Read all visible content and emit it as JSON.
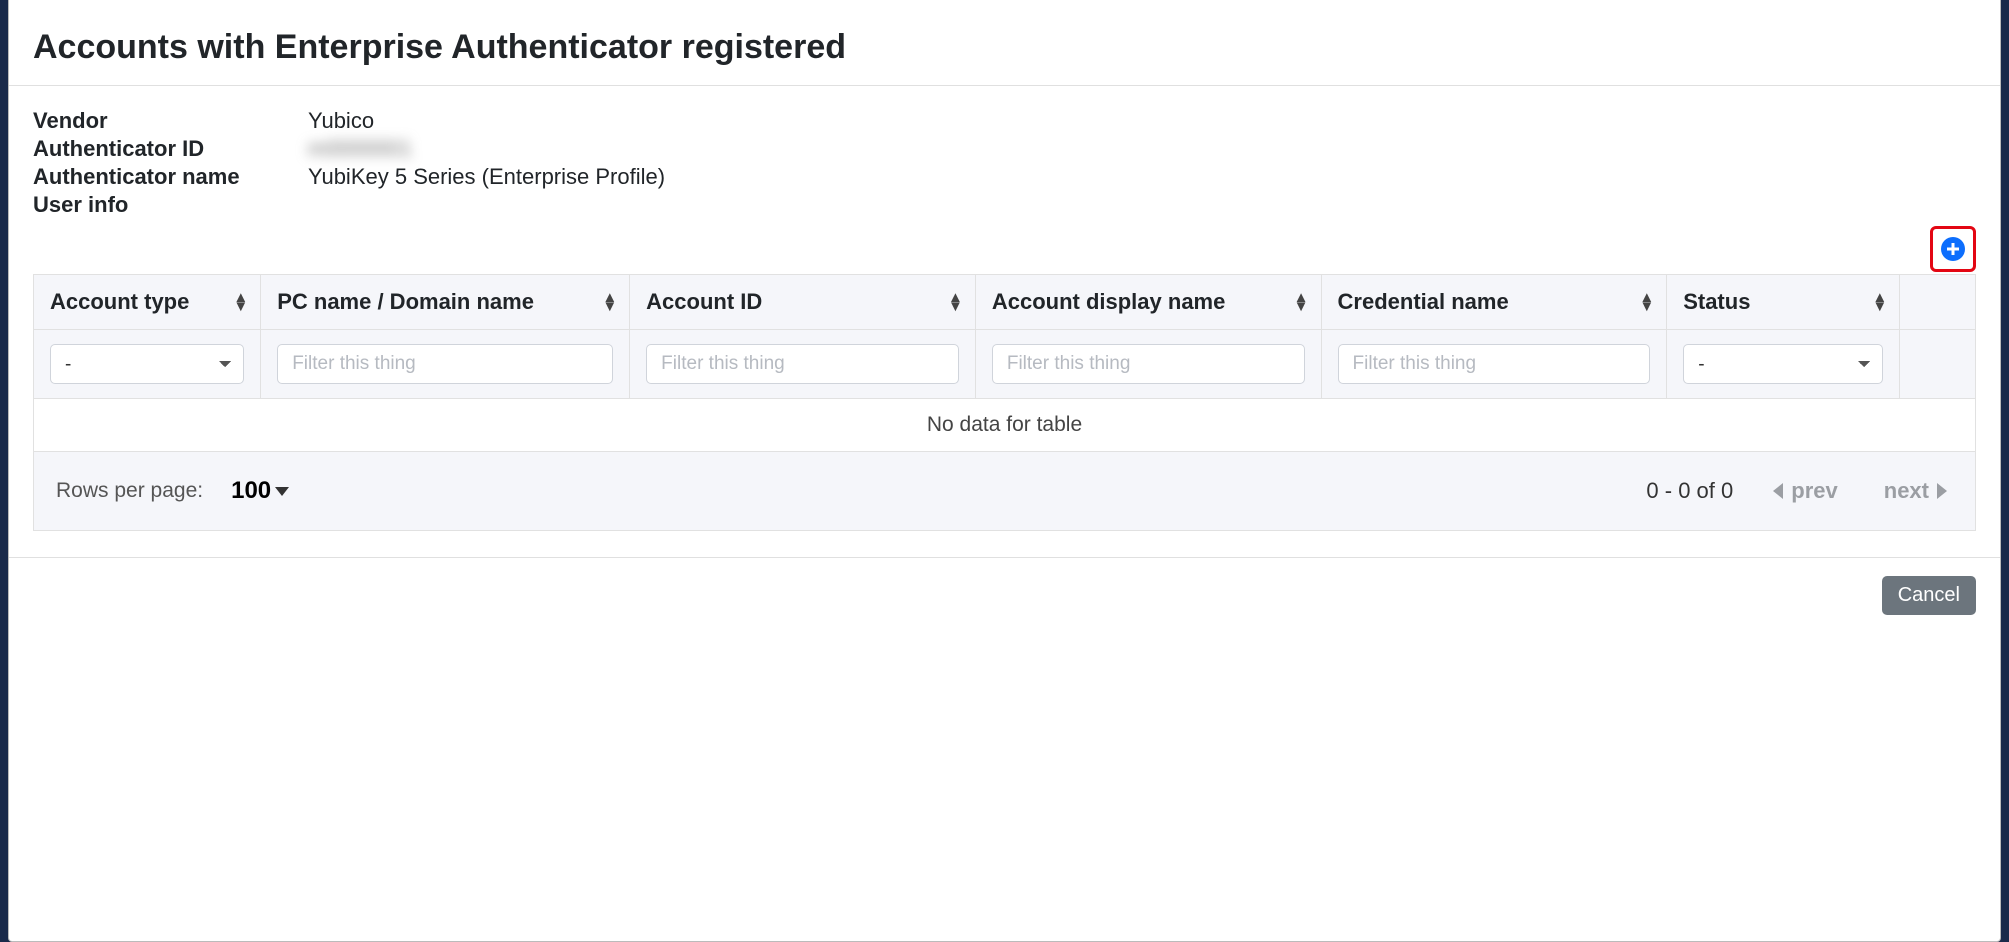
{
  "dialog": {
    "title": "Accounts with Enterprise Authenticator registered"
  },
  "info": {
    "vendor_label": "Vendor",
    "vendor_value": "Yubico",
    "auth_id_label": "Authenticator ID",
    "auth_id_value": "m0000001",
    "auth_name_label": "Authenticator name",
    "auth_name_value": "YubiKey 5 Series (Enterprise Profile)",
    "user_info_label": "User info",
    "user_info_value": ""
  },
  "columns": {
    "account_type": "Account type",
    "pc_name": "PC name / Domain name",
    "account_id": "Account ID",
    "display_name": "Account display name",
    "credential_name": "Credential name",
    "status": "Status"
  },
  "filters": {
    "placeholder": "Filter this thing",
    "dash_option": "-"
  },
  "table": {
    "no_data": "No data for table"
  },
  "pager": {
    "rows_label": "Rows per page:",
    "rows_value": "100",
    "range": "0 - 0 of 0",
    "prev": "prev",
    "next": "next"
  },
  "actions": {
    "cancel": "Cancel"
  }
}
